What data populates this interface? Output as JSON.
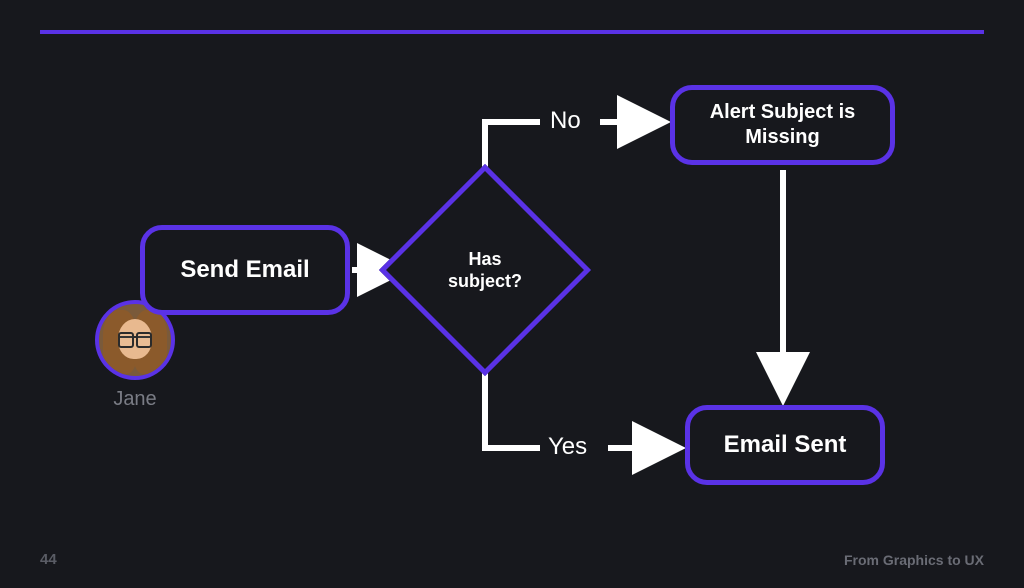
{
  "slide": {
    "number": "44",
    "footer": "From Graphics to UX"
  },
  "actor": {
    "name": "Jane"
  },
  "nodes": {
    "send_email": "Send Email",
    "decision": "Has\nsubject?",
    "alert_missing": "Alert Subject is Missing",
    "email_sent": "Email Sent"
  },
  "edges": {
    "no": "No",
    "yes": "Yes"
  },
  "chart_data": {
    "type": "flowchart",
    "actor": "Jane",
    "nodes": [
      {
        "id": "send_email",
        "type": "process",
        "label": "Send Email"
      },
      {
        "id": "has_subject",
        "type": "decision",
        "label": "Has subject?"
      },
      {
        "id": "alert_missing",
        "type": "process",
        "label": "Alert Subject is Missing"
      },
      {
        "id": "email_sent",
        "type": "terminal",
        "label": "Email Sent"
      }
    ],
    "edges": [
      {
        "from": "send_email",
        "to": "has_subject",
        "label": ""
      },
      {
        "from": "has_subject",
        "to": "alert_missing",
        "label": "No"
      },
      {
        "from": "has_subject",
        "to": "email_sent",
        "label": "Yes"
      },
      {
        "from": "alert_missing",
        "to": "email_sent",
        "label": ""
      }
    ]
  }
}
